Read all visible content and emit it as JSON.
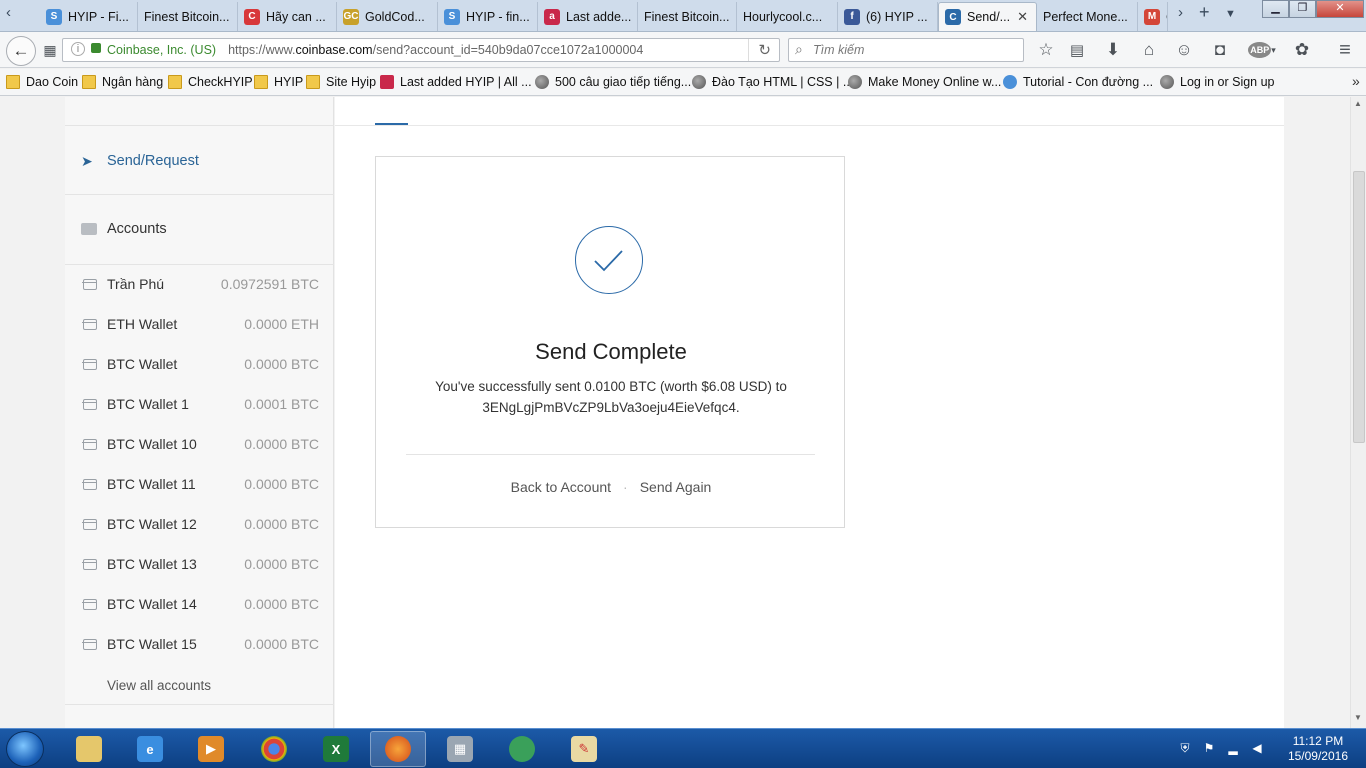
{
  "browser": {
    "tabs": [
      {
        "label": "HYIP - Fi...",
        "icon_color": "#4a90d9",
        "icon_glyph": "S"
      },
      {
        "label": "Finest Bitcoin...",
        "icon_color": "",
        "icon_glyph": ""
      },
      {
        "label": "Hãy can ...",
        "icon_color": "#d8383a",
        "icon_glyph": "C"
      },
      {
        "label": "GoldCod...",
        "icon_color": "#c8a12a",
        "icon_glyph": "GC"
      },
      {
        "label": "HYIP - fin...",
        "icon_color": "#4a90d9",
        "icon_glyph": "S"
      },
      {
        "label": "Last adde...",
        "icon_color": "#c9284a",
        "icon_glyph": "a"
      },
      {
        "label": "Finest Bitcoin...",
        "icon_color": "",
        "icon_glyph": ""
      },
      {
        "label": "Hourlycool.c...",
        "icon_color": "",
        "icon_glyph": ""
      },
      {
        "label": "(6) HYIP ...",
        "icon_color": "#3b5998",
        "icon_glyph": "f"
      },
      {
        "label": "Send/...",
        "icon_color": "#2b6aa8",
        "icon_glyph": "C"
      },
      {
        "label": "Perfect Mone...",
        "icon_color": "",
        "icon_glyph": ""
      },
      {
        "label": "C",
        "icon_color": "#d44638",
        "icon_glyph": "M"
      }
    ],
    "active_tab_index": 9,
    "url_site": "Coinbase, Inc. (US)",
    "url_prefix": "https://www.",
    "url_domain": "coinbase.com",
    "url_path": "/send?account_id=540b9da07cce1072a1000004",
    "search_placeholder": "Tìm kiếm",
    "bookmarks": [
      {
        "label": "Dao Coin",
        "type": "folder"
      },
      {
        "label": "Ngân hàng",
        "type": "folder"
      },
      {
        "label": "CheckHYIP",
        "type": "folder"
      },
      {
        "label": "HYIP",
        "type": "folder"
      },
      {
        "label": "Site Hyip",
        "type": "folder"
      },
      {
        "label": "Last added HYIP | All ...",
        "type": "a"
      },
      {
        "label": "500 câu giao tiếp tiếng...",
        "type": "globe"
      },
      {
        "label": "Đào Tạo HTML | CSS | ...",
        "type": "globe"
      },
      {
        "label": "Make Money Online w...",
        "type": "globe"
      },
      {
        "label": "Tutorial - Con đường ...",
        "type": "s"
      },
      {
        "label": "Log in or Sign up",
        "type": "globe"
      }
    ]
  },
  "sidebar": {
    "send_request_label": "Send/Request",
    "accounts_label": "Accounts",
    "accounts": [
      {
        "name": "Trần Phú",
        "balance": "0.0972591 BTC"
      },
      {
        "name": "ETH Wallet",
        "balance": "0.0000 ETH"
      },
      {
        "name": "BTC Wallet",
        "balance": "0.0000 BTC"
      },
      {
        "name": "BTC Wallet 1",
        "balance": "0.0001 BTC"
      },
      {
        "name": "BTC Wallet 10",
        "balance": "0.0000 BTC"
      },
      {
        "name": "BTC Wallet 11",
        "balance": "0.0000 BTC"
      },
      {
        "name": "BTC Wallet 12",
        "balance": "0.0000 BTC"
      },
      {
        "name": "BTC Wallet 13",
        "balance": "0.0000 BTC"
      },
      {
        "name": "BTC Wallet 14",
        "balance": "0.0000 BTC"
      },
      {
        "name": "BTC Wallet 15",
        "balance": "0.0000 BTC"
      }
    ],
    "view_all_label": "View all accounts"
  },
  "send_complete": {
    "title": "Send Complete",
    "message_line1": "You've successfully sent 0.0100 BTC (worth $6.08 USD) to",
    "message_line2": "3ENgLgjPmBVcZP9LbVa3oeju4EieVefqc4.",
    "back_label": "Back to Account",
    "separator": "·",
    "send_again_label": "Send Again",
    "accent_color": "#2b6aa8"
  },
  "taskbar": {
    "time": "11:12 PM",
    "date": "15/09/2016"
  }
}
